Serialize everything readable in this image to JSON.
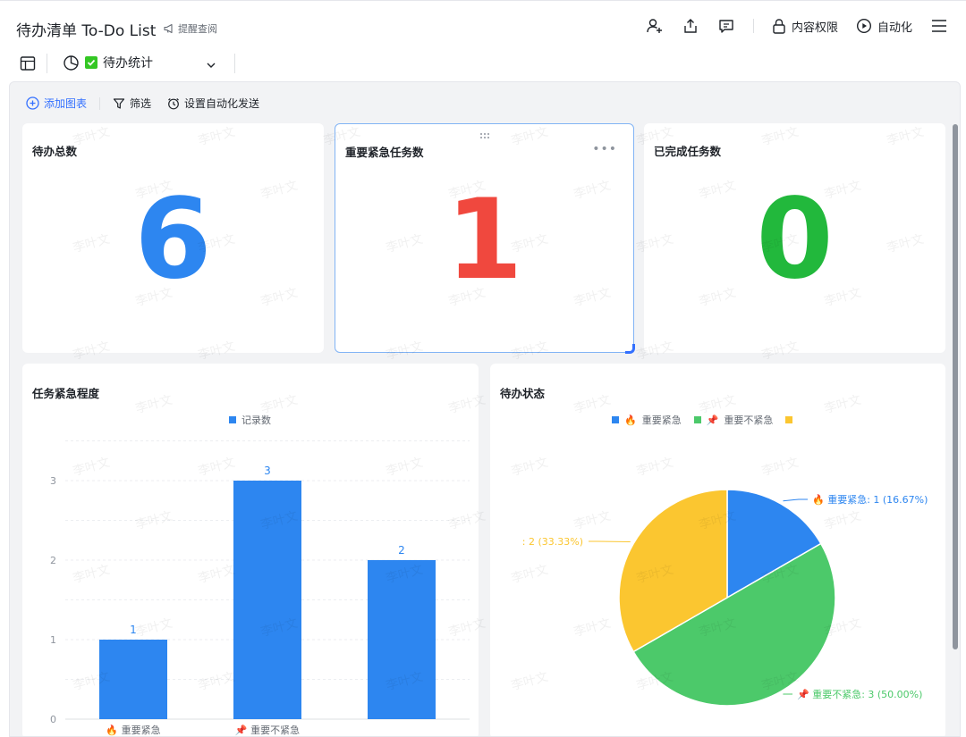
{
  "header": {
    "title": "待办清单 To-Do List",
    "remind_label": "提醒查阅",
    "permission_label": "内容权限",
    "automation_label": "自动化"
  },
  "view": {
    "tab_label": "待办统计"
  },
  "toolbar": {
    "add_chart": "添加图表",
    "filter": "筛选",
    "auto_send": "设置自动化发送"
  },
  "stats": [
    {
      "title": "待办总数",
      "value": "6",
      "color": "#2d86f0"
    },
    {
      "title": "重要紧急任务数",
      "value": "1",
      "color": "#f0483e"
    },
    {
      "title": "已完成任务数",
      "value": "0",
      "color": "#22b83c"
    }
  ],
  "bar_card": {
    "title": "任务紧急程度",
    "legend": "记录数",
    "categories": [
      "重要紧急",
      "重要不紧急",
      ""
    ],
    "category_icons": [
      "🔥",
      "📌",
      ""
    ]
  },
  "pie_card": {
    "title": "待办状态",
    "legend": [
      {
        "icon": "🔥",
        "label": "重要紧急",
        "color": "#2d86f0"
      },
      {
        "icon": "📌",
        "label": "重要不紧急",
        "color": "#4cc96a"
      },
      {
        "icon": "",
        "label": "",
        "color": "#fbc630"
      }
    ],
    "labels": [
      {
        "text": "重要紧急: 1 (16.67%)",
        "icon": "🔥"
      },
      {
        "text": "重要不紧急: 3 (50.00%)",
        "icon": "📌"
      },
      {
        "text": ": 2 (33.33%)",
        "icon": ""
      }
    ]
  },
  "watermark": "李叶文",
  "chart_data": [
    {
      "type": "bar",
      "title": "",
      "categories": [
        "重要紧急",
        "重要不紧急",
        ""
      ],
      "series": [
        {
          "name": "记录数",
          "values": [
            1,
            3,
            2
          ],
          "color": "#2d86f0"
        }
      ],
      "ylim": [
        0,
        3
      ],
      "yticks": [
        0,
        1,
        2,
        3
      ],
      "grid": true,
      "legend": "top-center"
    },
    {
      "type": "pie",
      "title": "",
      "labels": [
        "重要紧急",
        "重要不紧急",
        ""
      ],
      "values": [
        1,
        3,
        2
      ],
      "percents": [
        16.67,
        50.0,
        33.33
      ],
      "colors": [
        "#2d86f0",
        "#4cc96a",
        "#fbc630"
      ],
      "legend": "top-center"
    }
  ]
}
